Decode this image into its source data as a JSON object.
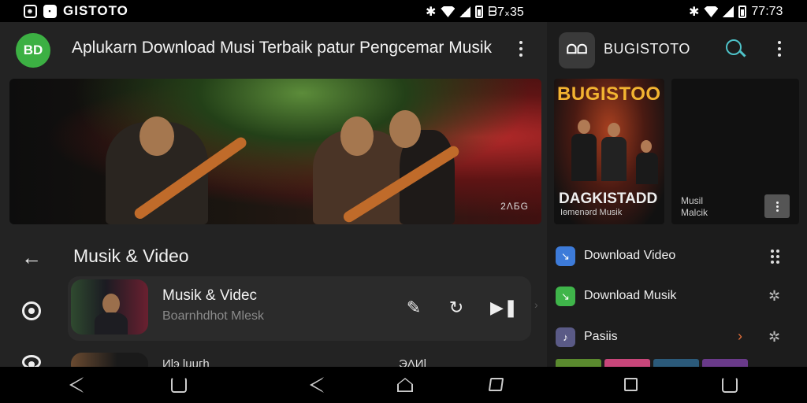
{
  "statusbar": {
    "app_name": "GISTOTO",
    "time_left": "ᗷ7᙮35",
    "time_right": "77:73"
  },
  "left": {
    "logo_text": "BD",
    "title": "Aplukarn Download Musi Terbaik patur Pengcemar Musik",
    "hero_caption": "2ΛБG",
    "section_title": "Musik & Video",
    "card": {
      "title": "Musik & Videc",
      "subtitle": "Boarnhdhot Mlesk"
    },
    "card2": {
      "title": "Иlэ luuгһ",
      "right": "ЭΛИl"
    }
  },
  "right": {
    "logo_text": "ᗝᗝ",
    "title": "BUGISTOTO",
    "card1": {
      "top": "BUGISTOO",
      "big": "DAGKISTADD",
      "small": "Iөmenәrd Musik"
    },
    "card2": {
      "line1": "Musil",
      "line2": "Malcik"
    },
    "items": [
      {
        "label": "Download Video",
        "icon_color": "#3d7bd9",
        "icon": "download-video-icon"
      },
      {
        "label": "Download Musik",
        "icon_color": "#3fb54a",
        "icon": "download-music-icon"
      },
      {
        "label": "Pasiis",
        "icon_color": "#5a5a86",
        "icon": "playlist-icon"
      }
    ]
  },
  "colors": {
    "accent_green": "#3cb043",
    "accent_teal": "#4ec3c9",
    "accent_gold": "#f3b431",
    "accent_orange": "#e6703a"
  }
}
